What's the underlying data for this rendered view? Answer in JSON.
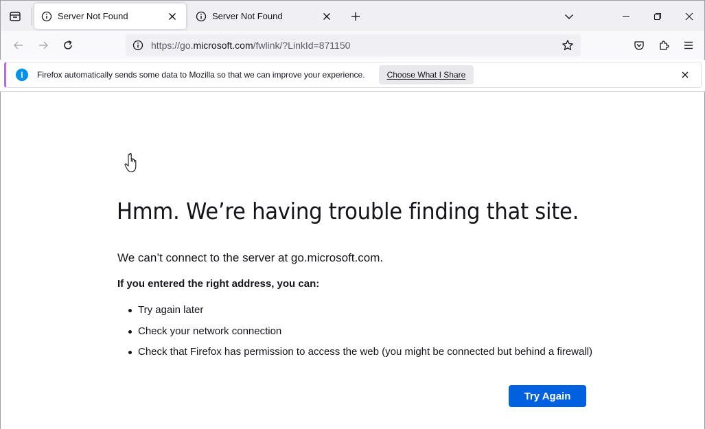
{
  "tabs": [
    {
      "title": "Server Not Found",
      "active": true
    },
    {
      "title": "Server Not Found",
      "active": false
    }
  ],
  "navbar": {
    "url_prefix": "https://go.",
    "url_host": "microsoft.com",
    "url_suffix": "/fwlink/?LinkId=871150"
  },
  "notification": {
    "message": "Firefox automatically sends some data to Mozilla so that we can improve your experience.",
    "button_label": "Choose What I Share",
    "info_glyph": "i"
  },
  "error_page": {
    "title": "Hmm. We’re having trouble finding that site.",
    "description": "We can’t connect to the server at go.microsoft.com.",
    "subheading": "If you entered the right address, you can:",
    "suggestions": [
      "Try again later",
      "Check your network connection",
      "Check that Firefox has permission to access the web (you might be connected but behind a firewall)"
    ],
    "try_again_label": "Try Again"
  },
  "colors": {
    "accent": "#0061e0",
    "info": "#0090ed",
    "notification_stripe": "#b76cd9"
  },
  "icons": [
    "tab-list-icon",
    "info-icon",
    "close-icon",
    "plus-icon",
    "chevron-down-icon",
    "minimize-icon",
    "restore-icon",
    "back-icon",
    "forward-icon",
    "reload-icon",
    "star-icon",
    "pocket-icon",
    "extensions-icon",
    "menu-icon",
    "hand-cursor-icon"
  ]
}
